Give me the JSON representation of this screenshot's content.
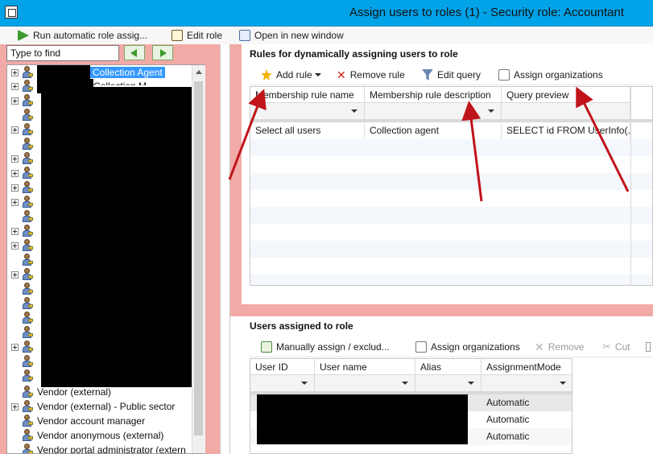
{
  "window": {
    "title": "Assign users to roles (1) - Security role: Accountant"
  },
  "commandbar": {
    "run_label": "Run automatic role assig...",
    "edit_role_label": "Edit role",
    "open_window_label": "Open in new window"
  },
  "tree": {
    "search_placeholder": "Type to find",
    "items": [
      {
        "label": "Collection Agent",
        "selected": true,
        "expandable": true
      },
      {
        "label": "Collection M",
        "selected": false,
        "expandable": true
      },
      {
        "label": "Vendor (external)",
        "selected": false,
        "expandable": false
      },
      {
        "label": "Vendor (external) - Public sector",
        "selected": false,
        "expandable": true
      },
      {
        "label": "Vendor account manager",
        "selected": false,
        "expandable": false
      },
      {
        "label": "Vendor anonymous (external)",
        "selected": false,
        "expandable": false
      },
      {
        "label": "Vendor portal administrator (extern",
        "selected": false,
        "expandable": false
      }
    ]
  },
  "rules": {
    "title": "Rules for dynamically assigning users to role",
    "toolbar": {
      "add_rule": "Add rule",
      "remove_rule": "Remove rule",
      "edit_query": "Edit query",
      "assign_orgs": "Assign organizations"
    },
    "columns": [
      "Membership rule name",
      "Membership rule description",
      "Query preview"
    ],
    "rows": [
      {
        "name": "Select all users",
        "description": "Collection agent",
        "query": "SELECT id FROM UserInfo(..."
      }
    ]
  },
  "users": {
    "title": "Users assigned to role",
    "toolbar": {
      "manual_assign": "Manually assign / exclud...",
      "assign_orgs": "Assign organizations",
      "remove": "Remove",
      "cut": "Cut"
    },
    "columns": [
      "User ID",
      "User name",
      "Alias",
      "AssignmentMode"
    ],
    "rows": [
      {
        "mode": "Automatic"
      },
      {
        "mode": "Automatic"
      },
      {
        "mode": "Automatic"
      }
    ]
  },
  "colors": {
    "titlebar": "#00a2e8",
    "pane_background": "#f2aaa6",
    "selection": "#3399ff",
    "annotation_arrow": "#c0141b"
  }
}
